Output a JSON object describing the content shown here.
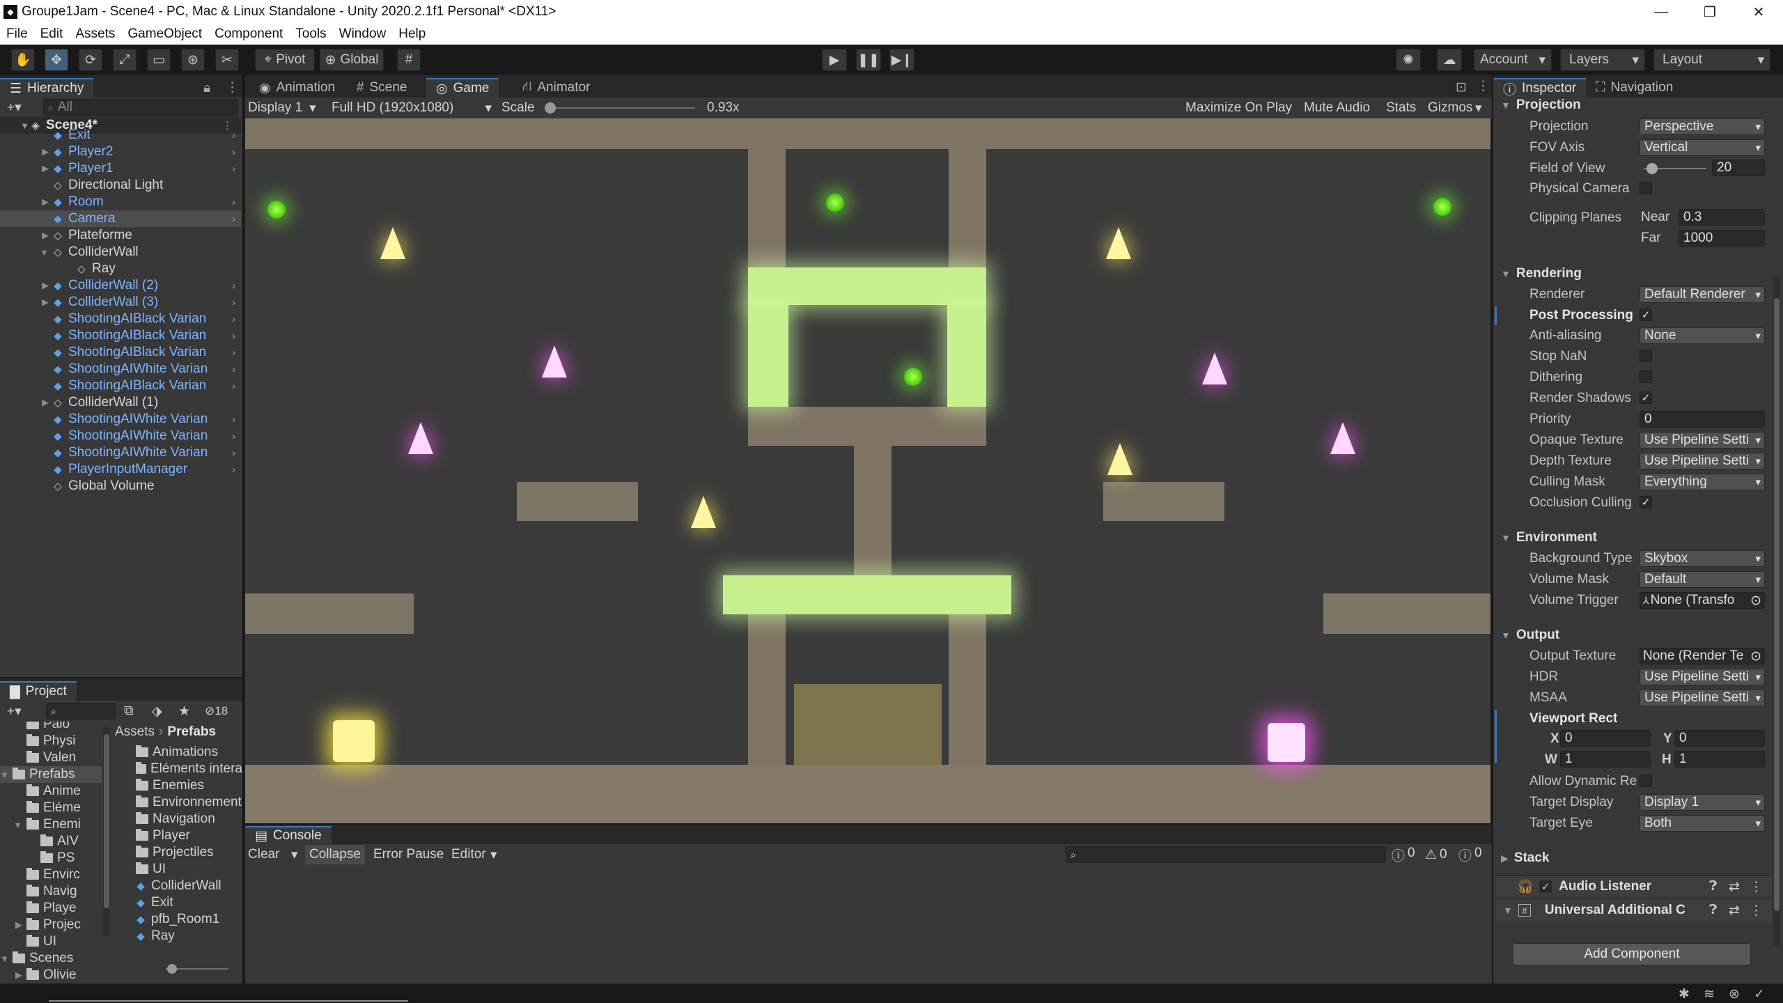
{
  "window": {
    "title": "Groupe1Jam - Scene4 - PC, Mac & Linux Standalone - Unity 2020.2.1f1 Personal* <DX11>",
    "minimize": "—",
    "maximize": "❐",
    "close": "✕"
  },
  "menu": [
    "File",
    "Edit",
    "Assets",
    "GameObject",
    "Component",
    "Tools",
    "Window",
    "Help"
  ],
  "toolbar": {
    "pivot": "Pivot",
    "global": "Global",
    "account": "Account",
    "layers": "Layers",
    "layout": "Layout"
  },
  "hierarchy": {
    "tab": "Hierarchy",
    "search_placeholder": "All",
    "scene": "Scene4*",
    "items": [
      {
        "label": "Exit",
        "prefab": true
      },
      {
        "label": "Player2",
        "prefab": true
      },
      {
        "label": "Player1",
        "prefab": true
      },
      {
        "label": "Directional Light",
        "prefab": false
      },
      {
        "label": "Room",
        "prefab": true
      },
      {
        "label": "Camera",
        "prefab": true
      },
      {
        "label": "Plateforme",
        "prefab": false
      },
      {
        "label": "ColliderWall",
        "prefab": false
      },
      {
        "label": "Ray",
        "prefab": false
      },
      {
        "label": "ColliderWall (2)",
        "prefab": true
      },
      {
        "label": "ColliderWall (3)",
        "prefab": true
      },
      {
        "label": "ShootingAIBlack Varian",
        "prefab": true
      },
      {
        "label": "ShootingAIBlack Varian",
        "prefab": true
      },
      {
        "label": "ShootingAIBlack Varian",
        "prefab": true
      },
      {
        "label": "ShootingAIWhite Varian",
        "prefab": true
      },
      {
        "label": "ShootingAIBlack Varian",
        "prefab": true
      },
      {
        "label": "ColliderWall (1)",
        "prefab": false
      },
      {
        "label": "ShootingAIWhite Varian",
        "prefab": true
      },
      {
        "label": "ShootingAIWhite Varian",
        "prefab": true
      },
      {
        "label": "ShootingAIWhite Varian",
        "prefab": true
      },
      {
        "label": "PlayerInputManager",
        "prefab": true
      },
      {
        "label": "Global Volume",
        "prefab": false
      }
    ]
  },
  "center_tabs": [
    "Animation",
    "Scene",
    "Game",
    "Animator"
  ],
  "game": {
    "display": "Display 1",
    "resolution": "Full HD (1920x1080)",
    "scale_label": "Scale",
    "scale_value": "0.93x",
    "scale_fraction": 0.0,
    "maximize": "Maximize On Play",
    "mute": "Mute Audio",
    "stats": "Stats",
    "gizmos": "Gizmos"
  },
  "project": {
    "tab": "Project",
    "hidden_count": "18",
    "tree": [
      "Palo",
      "Physi",
      "Valen",
      "Prefabs",
      "Anime",
      "Eléme",
      "Enemi",
      "AIV",
      "PS",
      "Envirc",
      "Navig",
      "Playe",
      "Projec",
      "UI",
      "Scenes",
      "Olivie"
    ],
    "breadcrumb": [
      "Assets",
      "Prefabs"
    ],
    "folders": [
      "Animations",
      "Eléments intera",
      "Enemies",
      "Environnement",
      "Navigation",
      "Player",
      "Projectiles",
      "UI"
    ],
    "assets": [
      "ColliderWall",
      "Exit",
      "pfb_Room1",
      "Ray"
    ]
  },
  "console": {
    "tab": "Console",
    "clear": "Clear",
    "collapse": "Collapse",
    "error_pause": "Error Pause",
    "editor": "Editor",
    "info_count": "0",
    "warn_count": "0",
    "error_count": "0"
  },
  "inspector": {
    "tabs": [
      "Inspector",
      "Navigation"
    ],
    "projection": {
      "header": "Projection",
      "projection_label": "Projection",
      "projection_value": "Perspective",
      "fov_axis_label": "FOV Axis",
      "fov_axis_value": "Vertical",
      "fov_label": "Field of View",
      "fov_value": "20",
      "physical_label": "Physical Camera",
      "clipping_label": "Clipping Planes",
      "near_label": "Near",
      "near_value": "0.3",
      "far_label": "Far",
      "far_value": "1000"
    },
    "rendering": {
      "header": "Rendering",
      "renderer_label": "Renderer",
      "renderer_value": "Default Renderer",
      "post_label": "Post Processing",
      "aa_label": "Anti-aliasing",
      "aa_value": "None",
      "stopnan_label": "Stop NaN",
      "dither_label": "Dithering",
      "shadows_label": "Render Shadows",
      "priority_label": "Priority",
      "priority_value": "0",
      "opaque_label": "Opaque Texture",
      "opaque_value": "Use Pipeline Setti",
      "depth_label": "Depth Texture",
      "depth_value": "Use Pipeline Setti",
      "culling_label": "Culling Mask",
      "culling_value": "Everything",
      "occlusion_label": "Occlusion Culling"
    },
    "environment": {
      "header": "Environment",
      "bg_label": "Background Type",
      "bg_value": "Skybox",
      "vmask_label": "Volume Mask",
      "vmask_value": "Default",
      "vtrigger_label": "Volume Trigger",
      "vtrigger_value": "None (Transfo"
    },
    "output": {
      "header": "Output",
      "otex_label": "Output Texture",
      "otex_value": "None (Render Te",
      "hdr_label": "HDR",
      "hdr_value": "Use Pipeline Setti",
      "msaa_label": "MSAA",
      "msaa_value": "Use Pipeline Setti",
      "viewport_label": "Viewport Rect",
      "x_label": "X",
      "x_value": "0",
      "y_label": "Y",
      "y_value": "0",
      "w_label": "W",
      "w_value": "1",
      "h_label": "H",
      "h_value": "1",
      "dynres_label": "Allow Dynamic Re",
      "tdisplay_label": "Target Display",
      "tdisplay_value": "Display 1",
      "teye_label": "Target Eye",
      "teye_value": "Both"
    },
    "stack_header": "Stack",
    "audio_listener": "Audio Listener",
    "universal_additional": "Universal Additional C",
    "add_component": "Add Component"
  }
}
